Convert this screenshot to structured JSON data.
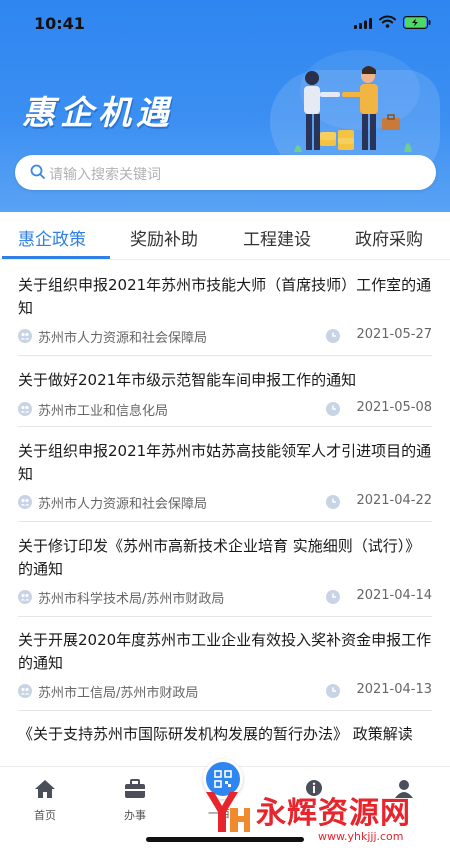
{
  "status_bar": {
    "time": "10:41"
  },
  "header": {
    "title": "惠企机遇"
  },
  "search": {
    "placeholder": "请输入搜索关键词"
  },
  "tabs": [
    {
      "label": "惠企政策",
      "active": true
    },
    {
      "label": "奖励补助",
      "active": false
    },
    {
      "label": "工程建设",
      "active": false
    },
    {
      "label": "政府采购",
      "active": false
    }
  ],
  "items": [
    {
      "title": "关于组织申报2021年苏州市技能大师（首席技师）工作室的通知",
      "org": "苏州市人力资源和社会保障局",
      "date": "2021-05-27"
    },
    {
      "title": "关于做好2021年市级示范智能车间申报工作的通知",
      "org": "苏州市工业和信息化局",
      "date": "2021-05-08"
    },
    {
      "title": "关于组织申报2021年苏州市姑苏高技能领军人才引进项目的通知",
      "org": "苏州市人力资源和社会保障局",
      "date": "2021-04-22"
    },
    {
      "title": "关于修订印发《苏州市高新技术企业培育 实施细则（试行）》的通知",
      "org": "苏州市科学技术局/苏州市财政局",
      "date": "2021-04-14"
    },
    {
      "title": "关于开展2020年度苏州市工业企业有效投入奖补资金申报工作的通知",
      "org": "苏州市工信局/苏州市财政局",
      "date": "2021-04-13"
    },
    {
      "title": "《关于支持苏州市国际研发机构发展的暂行办法》 政策解读",
      "org": "",
      "date": ""
    }
  ],
  "bottom_nav": [
    {
      "label": "首页",
      "icon": "home-icon"
    },
    {
      "label": "办事",
      "icon": "briefcase-icon"
    },
    {
      "label": "一亩",
      "icon": "qr-code-icon"
    },
    {
      "label": "",
      "icon": "info-icon"
    },
    {
      "label": "",
      "icon": "user-icon"
    }
  ],
  "watermark": {
    "name": "永辉资源网",
    "url": "www.yhkjjj.com"
  },
  "colors": {
    "primary": "#2f7fe6",
    "hero": "#3b8ff2",
    "watermark": "#e8252c"
  }
}
